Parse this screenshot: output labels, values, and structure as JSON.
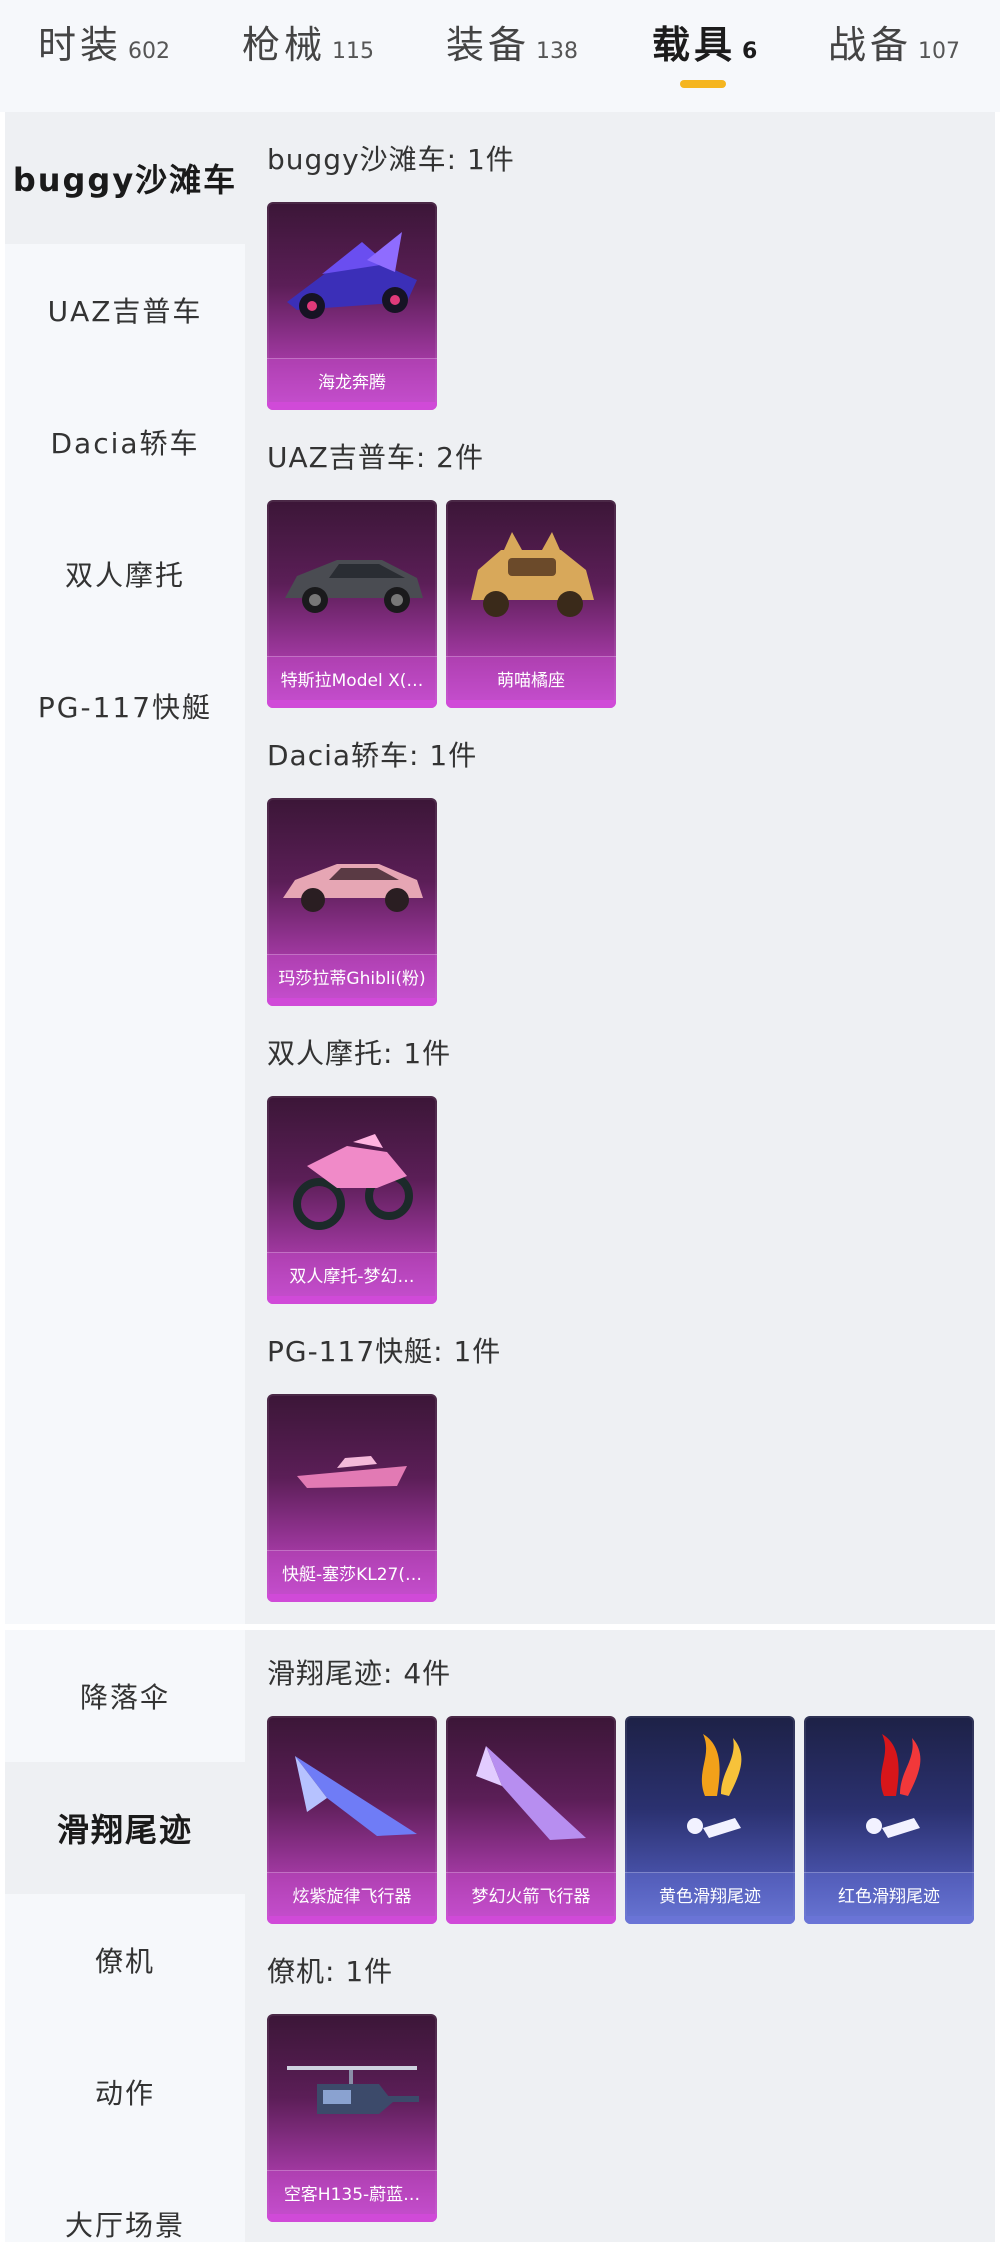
{
  "tabs": [
    {
      "label": "时装",
      "count": "602",
      "active": false
    },
    {
      "label": "枪械",
      "count": "115",
      "active": false
    },
    {
      "label": "装备",
      "count": "138",
      "active": false
    },
    {
      "label": "载具",
      "count": "6",
      "active": true
    },
    {
      "label": "战备",
      "count": "107",
      "active": false
    }
  ],
  "vehicles": {
    "sidebar": [
      {
        "label": "buggy沙滩车",
        "active": true
      },
      {
        "label": "UAZ吉普车",
        "active": false
      },
      {
        "label": "Dacia轿车",
        "active": false
      },
      {
        "label": "双人摩托",
        "active": false
      },
      {
        "label": "PG-117快艇",
        "active": false
      }
    ],
    "categories": [
      {
        "title": "buggy沙滩车: 1件",
        "items": [
          {
            "name": "海龙奔腾",
            "icon": "buggy-car-icon"
          }
        ]
      },
      {
        "title": "UAZ吉普车: 2件",
        "items": [
          {
            "name": "特斯拉Model X(…",
            "icon": "suv-car-icon"
          },
          {
            "name": "萌喵橘座",
            "icon": "cat-car-icon"
          }
        ]
      },
      {
        "title": "Dacia轿车: 1件",
        "items": [
          {
            "name": "玛莎拉蒂Ghibli(粉)",
            "icon": "sedan-car-icon"
          }
        ]
      },
      {
        "title": "双人摩托: 1件",
        "items": [
          {
            "name": "双人摩托-梦幻…",
            "icon": "motorcycle-icon"
          }
        ]
      },
      {
        "title": "PG-117快艇: 1件",
        "items": [
          {
            "name": "快艇-塞莎KL27(…",
            "icon": "speedboat-icon"
          }
        ]
      }
    ]
  },
  "gear": {
    "sidebar": [
      {
        "label": "降落伞",
        "active": false
      },
      {
        "label": "滑翔尾迹",
        "active": true
      },
      {
        "label": "僚机",
        "active": false
      },
      {
        "label": "动作",
        "active": false
      },
      {
        "label": "大厅场景",
        "active": false
      }
    ],
    "categories": [
      {
        "title": "滑翔尾迹: 4件",
        "items": [
          {
            "name": "炫紫旋律飞行器",
            "icon": "glider-icon",
            "tier": "purple"
          },
          {
            "name": "梦幻火箭飞行器",
            "icon": "rocket-glider-icon",
            "tier": "purple"
          },
          {
            "name": "黄色滑翔尾迹",
            "icon": "yellow-smoke-trail-icon",
            "tier": "blue"
          },
          {
            "name": "红色滑翔尾迹",
            "icon": "red-smoke-trail-icon",
            "tier": "blue"
          }
        ]
      },
      {
        "title": "僚机: 1件",
        "items": [
          {
            "name": "空客H135-蔚蓝…",
            "icon": "helicopter-icon",
            "tier": "purple"
          }
        ]
      }
    ]
  },
  "colors": {
    "accent_underline": "#f5b51f",
    "purple_card": "#a53aa5",
    "blue_card": "#4a54ad"
  }
}
